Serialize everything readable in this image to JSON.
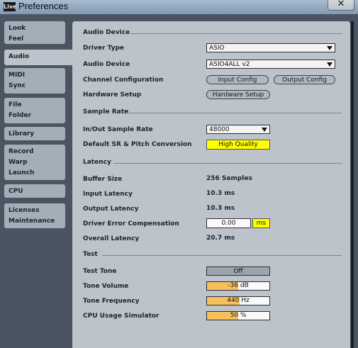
{
  "window": {
    "title": "Preferences",
    "logo_text": "Live",
    "close_glyph": "✕"
  },
  "sidebar": {
    "tabs": [
      {
        "lines": [
          "Look",
          "Feel"
        ]
      },
      {
        "lines": [
          "Audio"
        ]
      },
      {
        "lines": [
          "MIDI",
          "Sync"
        ]
      },
      {
        "lines": [
          "File",
          "Folder"
        ]
      },
      {
        "lines": [
          "Library"
        ]
      },
      {
        "lines": [
          "Record",
          "Warp",
          "Launch"
        ]
      },
      {
        "lines": [
          "CPU"
        ]
      },
      {
        "lines": [
          "Licenses",
          "Maintenance"
        ]
      }
    ],
    "active": "Audio"
  },
  "audio_device": {
    "section": "Audio Device",
    "driver_type_label": "Driver Type",
    "driver_type_value": "ASIO",
    "audio_device_label": "Audio Device",
    "audio_device_value": "ASIO4ALL v2",
    "channel_config_label": "Channel Configuration",
    "input_config": "Input Config",
    "output_config": "Output Config",
    "hardware_setup_label": "Hardware Setup",
    "hardware_setup_button": "Hardware Setup"
  },
  "sample_rate": {
    "section": "Sample Rate",
    "rate_label": "In/Out Sample Rate",
    "rate_value": "48000",
    "conversion_label": "Default SR & Pitch Conversion",
    "conversion_value": "High Quality"
  },
  "latency": {
    "section": "Latency",
    "buffer_label": "Buffer Size",
    "buffer_value": "256 Samples",
    "input_label": "Input Latency",
    "input_value": "10.3 ms",
    "output_label": "Output Latency",
    "output_value": "10.3 ms",
    "comp_label": "Driver Error Compensation",
    "comp_value": "0.00",
    "comp_unit": "ms",
    "overall_label": "Overall Latency",
    "overall_value": "20.7 ms"
  },
  "test": {
    "section": "Test",
    "tone_label": "Test Tone",
    "tone_value": "Off",
    "volume_label": "Tone Volume",
    "volume_value": "-36 dB",
    "volume_level": 0.5,
    "freq_label": "Tone Frequency",
    "freq_value": "440 Hz",
    "freq_level": 0.52,
    "cpu_label": "CPU Usage Simulator",
    "cpu_value": "50 %",
    "cpu_level": 0.5
  },
  "colors": {
    "accent_yellow": "#ffff00",
    "slider_fill": "#f7c05c",
    "panel": "#bcc3ca"
  }
}
